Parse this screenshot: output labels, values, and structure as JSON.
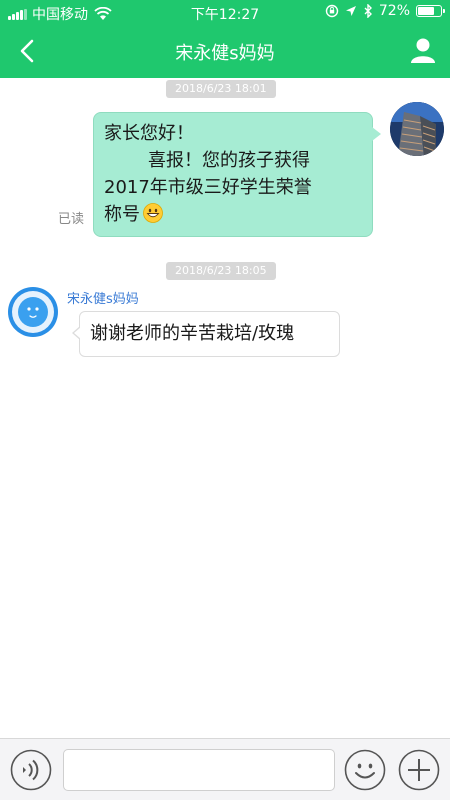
{
  "status_bar": {
    "carrier": "中国移动",
    "time": "下午12:27",
    "battery_text": "72%",
    "battery_level": 0.72
  },
  "nav": {
    "title": "宋永健s妈妈"
  },
  "messages": [
    {
      "timestamp": "2018/6/23 18:01",
      "from": "me",
      "lines": [
        "家长您好！",
        "喜报！您的孩子获得",
        "2017年市级三好学生荣誉",
        "称号"
      ],
      "emoji": "grinning-face",
      "status": "已读"
    },
    {
      "timestamp": "2018/6/23 18:05",
      "from": "peer",
      "sender_name": "宋永健s妈妈",
      "text": "谢谢老师的辛苦栽培/玫瑰"
    }
  ],
  "input": {
    "value": ""
  },
  "colors": {
    "header_green": "#1fc86e",
    "outgoing_bubble": "#a6ecd3",
    "peer_name": "#3a7bd5"
  },
  "icons": {
    "back": "chevron-left-icon",
    "profile": "person-icon",
    "voice": "voice-icon",
    "emoji": "smiley-icon",
    "plus": "plus-icon"
  }
}
